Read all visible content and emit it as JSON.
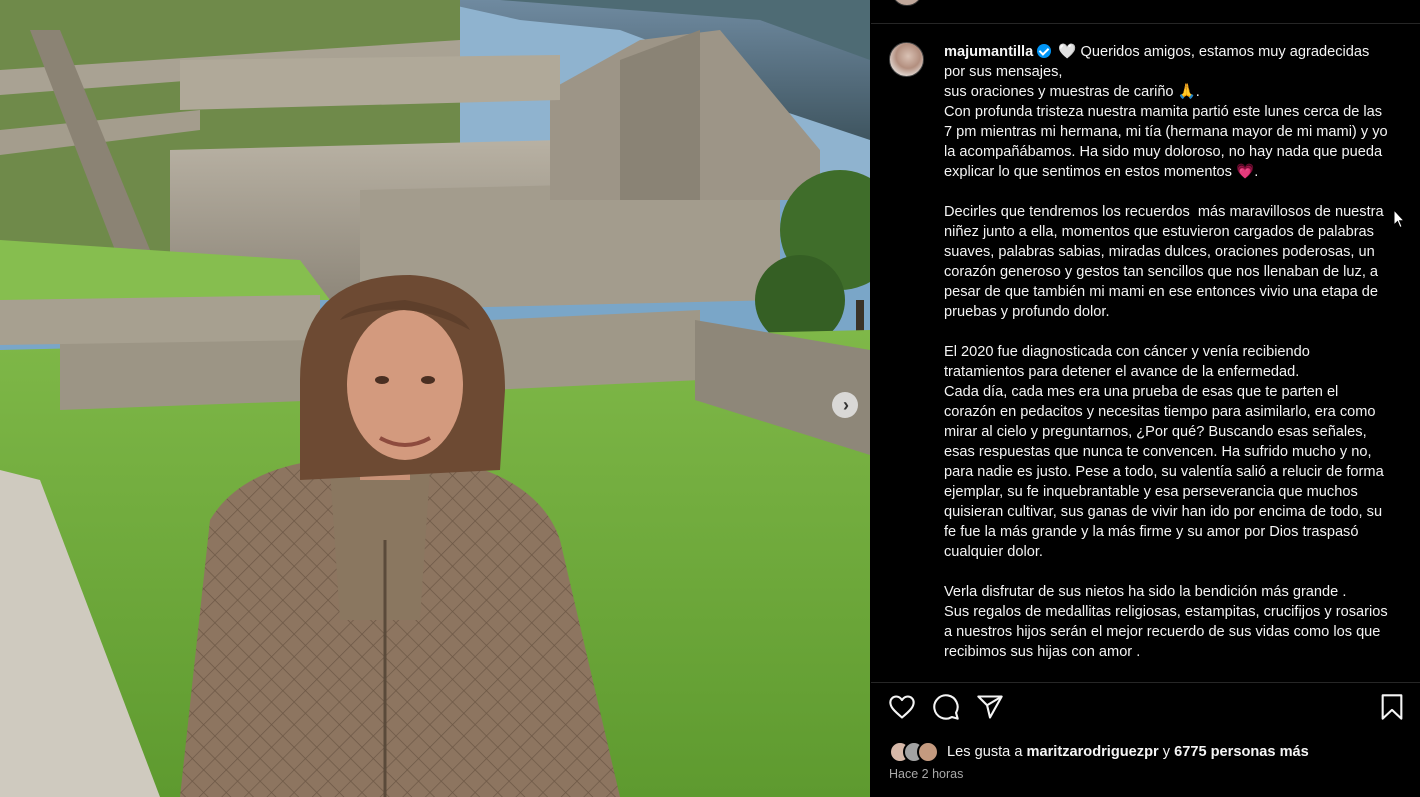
{
  "post": {
    "username": "majumantilla",
    "caption_first": " 🤍 Queridos amigos, estamos muy agradecidas\npor sus mensajes,\nsus oraciones y muestras de cariño 🙏.\nCon profunda tristeza nuestra mamita partió este lunes cerca de las 7 pm mientras mi hermana, mi tía (hermana mayor de mi mami) y yo la acompañábamos. Ha sido muy doloroso, no hay nada que pueda explicar lo que sentimos en estos momentos 💗.\n\nDecirles que tendremos los recuerdos  más maravillosos de nuestra niñez junto a ella, momentos que estuvieron cargados de palabras suaves, palabras sabias, miradas dulces, oraciones poderosas, un corazón generoso y gestos tan sencillos que nos llenaban de luz, a pesar de que también mi mami en ese entonces vivio una etapa de pruebas y profundo dolor.\n\nEl 2020 fue diagnosticada con cáncer y venía recibiendo tratamientos para detener el avance de la enfermedad.\nCada día, cada mes era una prueba de esas que te parten el corazón en pedacitos y necesitas tiempo para asimilarlo, era como mirar al cielo y preguntarnos, ¿Por qué? Buscando esas señales, esas respuestas que nunca te convencen. Ha sufrido mucho y no, para nadie es justo. Pese a todo, su valentía salió a relucir de forma ejemplar, su fe inquebrantable y esa perseverancia que muchos quisieran cultivar, sus ganas de vivir han ido por encima de todo, su fe fue la más grande y la más firme y su amor por Dios traspasó cualquier dolor.\n\nVerla disfrutar de sus nietos ha sido la bendición más grande .\nSus regalos de medallitas religiosas, estampitas, crucifijos y rosarios a nuestros hijos serán el mejor recuerdo de sus vidas como los que recibimos sus hijas con amor .",
    "likes_prefix": "Les gusta a ",
    "likes_user": "maritzarodriguezpr",
    "likes_joiner": " y ",
    "likes_count": "6775 personas más",
    "timestamp": "Hace 2 horas"
  },
  "icons": {
    "like": "heart-icon",
    "comment": "comment-icon",
    "share": "send-icon",
    "save": "bookmark-icon",
    "next": "chevron-right-icon",
    "verified": "verified-badge-icon"
  },
  "colors": {
    "background": "#000000",
    "text": "#f5f5f5",
    "muted": "#a8a8a8",
    "verified": "#0095f6",
    "divider": "#262626"
  }
}
